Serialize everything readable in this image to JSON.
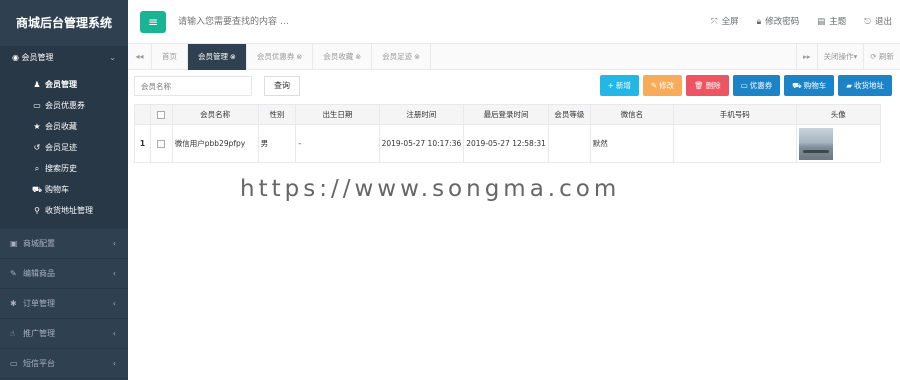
{
  "app": {
    "title": "商城后台管理系统"
  },
  "sidebar": {
    "active_group": {
      "icon": "user-circle-icon",
      "label": "会员管理",
      "chevron": "⌄"
    },
    "sub_items": [
      {
        "icon": "user-icon",
        "glyph": "♟",
        "label": "会员管理"
      },
      {
        "icon": "coupon-icon",
        "glyph": "▭",
        "label": "会员优惠券"
      },
      {
        "icon": "star-icon",
        "glyph": "★",
        "label": "会员收藏"
      },
      {
        "icon": "history-icon",
        "glyph": "↺",
        "label": "会员足迹"
      },
      {
        "icon": "search-icon",
        "glyph": "⌕",
        "label": "搜索历史"
      },
      {
        "icon": "cart-icon",
        "glyph": "⛟",
        "label": "购物车"
      },
      {
        "icon": "location-icon",
        "glyph": "⚲",
        "label": "收货地址管理"
      }
    ],
    "groups": [
      {
        "icon": "shop-icon",
        "glyph": "▣",
        "label": "商城配置",
        "chevron": "‹"
      },
      {
        "icon": "edit-icon",
        "glyph": "✎",
        "label": "编辑商品",
        "chevron": "‹"
      },
      {
        "icon": "order-icon",
        "glyph": "✱",
        "label": "订单管理",
        "chevron": "‹"
      },
      {
        "icon": "promotion-icon",
        "glyph": "☝",
        "label": "推广管理",
        "chevron": "‹"
      },
      {
        "icon": "sms-icon",
        "glyph": "▭",
        "label": "短信平台",
        "chevron": "‹"
      }
    ]
  },
  "header": {
    "menu_icon": "≡",
    "search_placeholder": "请输入您需要查找的内容 …",
    "links": [
      {
        "icon": "fullscreen-icon",
        "glyph": "⤧",
        "label": "全屏"
      },
      {
        "icon": "lock-icon",
        "glyph": "🔒",
        "label": "修改密码"
      },
      {
        "icon": "theme-icon",
        "glyph": "▤",
        "label": "主题"
      },
      {
        "icon": "logout-icon",
        "glyph": "⎋",
        "label": "退出"
      }
    ]
  },
  "tabs": {
    "prev": "◂◂",
    "next": "▸▸",
    "items": [
      {
        "label": "首页",
        "closable": false
      },
      {
        "label": "会员管理",
        "closable": true
      },
      {
        "label": "会员优惠券",
        "closable": true
      },
      {
        "label": "会员收藏",
        "closable": true
      },
      {
        "label": "会员足迹",
        "closable": true
      }
    ],
    "close_ops": "关闭操作▾",
    "refresh": "⟳ 刷新"
  },
  "toolbar": {
    "member_name_placeholder": "会员名称",
    "query_label": "查询",
    "buttons": [
      {
        "icon": "plus-icon",
        "glyph": "+",
        "label": "新增",
        "color": "#1c84c6"
      },
      {
        "icon": "edit-icon",
        "glyph": "✎",
        "label": "修改",
        "color": "#f8ac59"
      },
      {
        "icon": "trash-icon",
        "glyph": "🗑",
        "label": "删除",
        "color": "#ed5565"
      },
      {
        "icon": "coupon-icon",
        "glyph": "▭",
        "label": "优惠券",
        "color": "#1c84c6"
      },
      {
        "icon": "cart-icon",
        "glyph": "⛟",
        "label": "购物车",
        "color": "#1c84c6"
      },
      {
        "icon": "address-icon",
        "glyph": "▰",
        "label": "收货地址",
        "color": "#1c84c6"
      }
    ]
  },
  "table": {
    "headers": [
      "",
      "",
      "会员名称",
      "性别",
      "出生日期",
      "注册时间",
      "最后登录时间",
      "会员等级",
      "微信名",
      "手机号码",
      "头像"
    ],
    "rows": [
      {
        "index": "1",
        "member_name": "微信用户pbb29pfpy",
        "gender": "男",
        "birth_date": "-",
        "register_time": "2019-05-27 10:17:36",
        "last_login": "2019-05-27 12:58:31",
        "level": "",
        "wechat_name": "默然",
        "phone": ""
      }
    ]
  },
  "watermark": "https://www.songma.com"
}
